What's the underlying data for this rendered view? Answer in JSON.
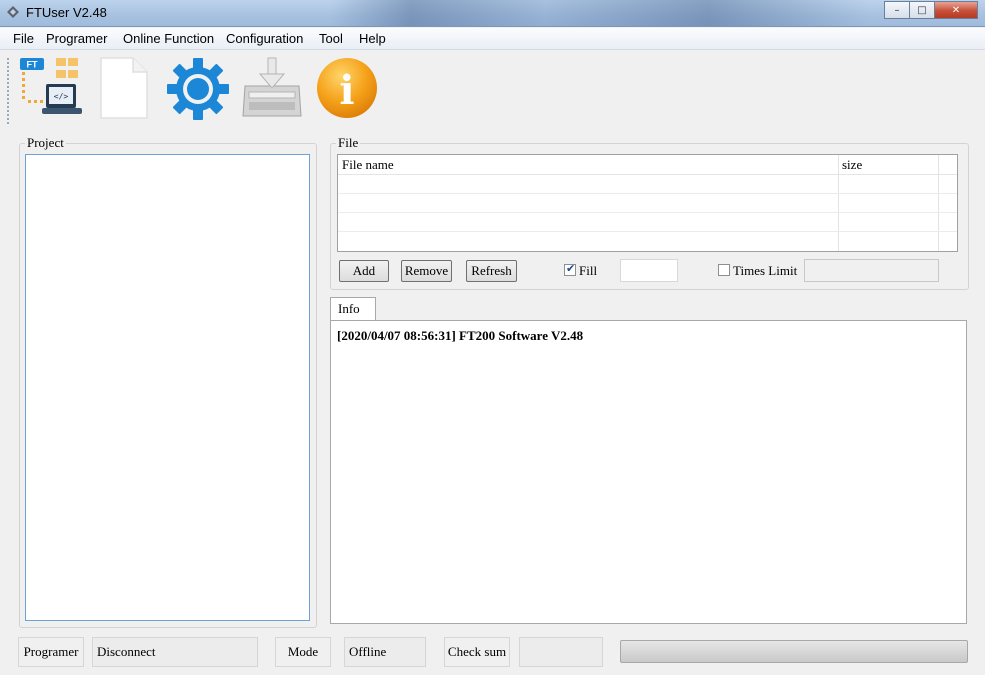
{
  "window": {
    "title": "FTUser V2.48",
    "controls": {
      "minimize": "–",
      "maximize": "□",
      "close": "✕"
    }
  },
  "menu": [
    "File",
    "Programer",
    "Online Function",
    "Configuration",
    "Tool",
    "Help"
  ],
  "toolbar": {
    "icons": [
      "project-icon",
      "new-file-icon",
      "settings-gear-icon",
      "download-tray-icon",
      "info-icon"
    ],
    "project_icon_badge": "FT",
    "project_icon_code": "</>",
    "info_icon_glyph": "i"
  },
  "project": {
    "label": "Project"
  },
  "file": {
    "label": "File",
    "columns": [
      "File name",
      "size"
    ],
    "rows": [],
    "buttons": {
      "add": "Add",
      "remove": "Remove",
      "refresh": "Refresh"
    },
    "fill": {
      "label": "Fill",
      "checked": true,
      "value": ""
    },
    "times_limit": {
      "label": "Times Limit",
      "checked": false,
      "value": ""
    }
  },
  "info": {
    "tab_label": "Info",
    "log": [
      "[2020/04/07 08:56:31] FT200 Software V2.48"
    ]
  },
  "status": {
    "programer_label": "Programer",
    "programer_value": "Disconnect",
    "mode_label": "Mode",
    "mode_value": "Offline",
    "checksum_label": "Check sum",
    "checksum_value": "",
    "progress": 0
  },
  "colors": {
    "accent_blue": "#1b87d6",
    "info_orange": "#f5a21a",
    "list_border": "#6ea2d5",
    "progress_fill": "#37b24d"
  }
}
